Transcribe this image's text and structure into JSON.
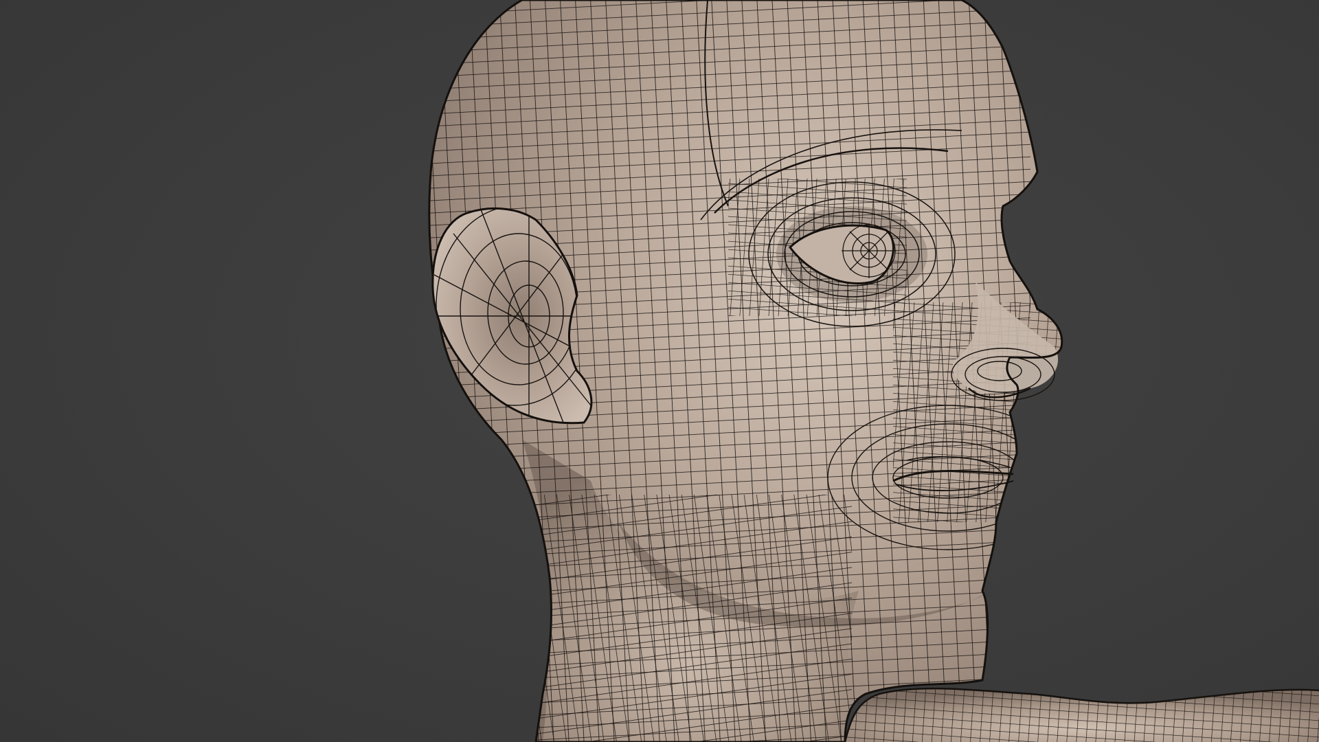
{
  "viewport": {
    "background_color": "#3b3b3b",
    "subject": "head-wireframe-mesh",
    "mesh_surface_color": "#b8a699",
    "mesh_highlight_color": "#d2c4b8",
    "mesh_shadow_color": "#8a7a6f",
    "wire_color": "#1a1512",
    "shading": "smooth-with-wireframe-overlay"
  }
}
